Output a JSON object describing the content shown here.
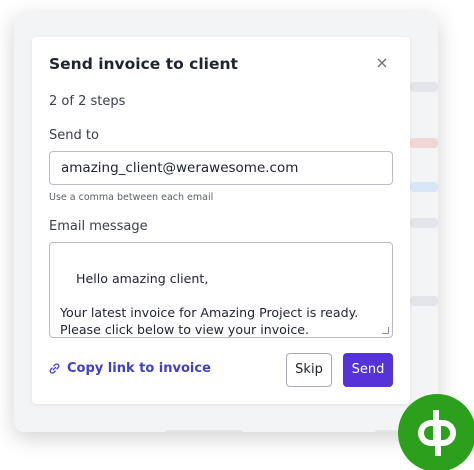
{
  "modal": {
    "title": "Send invoice to client",
    "close_icon": "×",
    "step": "2 of 2 steps",
    "send_to_label": "Send to",
    "send_to_value": "amazing_client@werawesome.com",
    "hint": "Use a comma between each email",
    "message_label": "Email message",
    "message_value": "Hello amazing client,\n\nYour latest invoice for Amazing Project is ready. Please click below to view your invoice.",
    "copy_link_label": "Copy link to invoice",
    "skip_label": "Skip",
    "send_label": "Send"
  },
  "colors": {
    "accent": "#5533d6",
    "link": "#3f3fc7",
    "logo": "#2ca01c"
  },
  "icons": {
    "close": "close-icon",
    "link": "link-icon",
    "logo": "quickbooks-logo"
  }
}
